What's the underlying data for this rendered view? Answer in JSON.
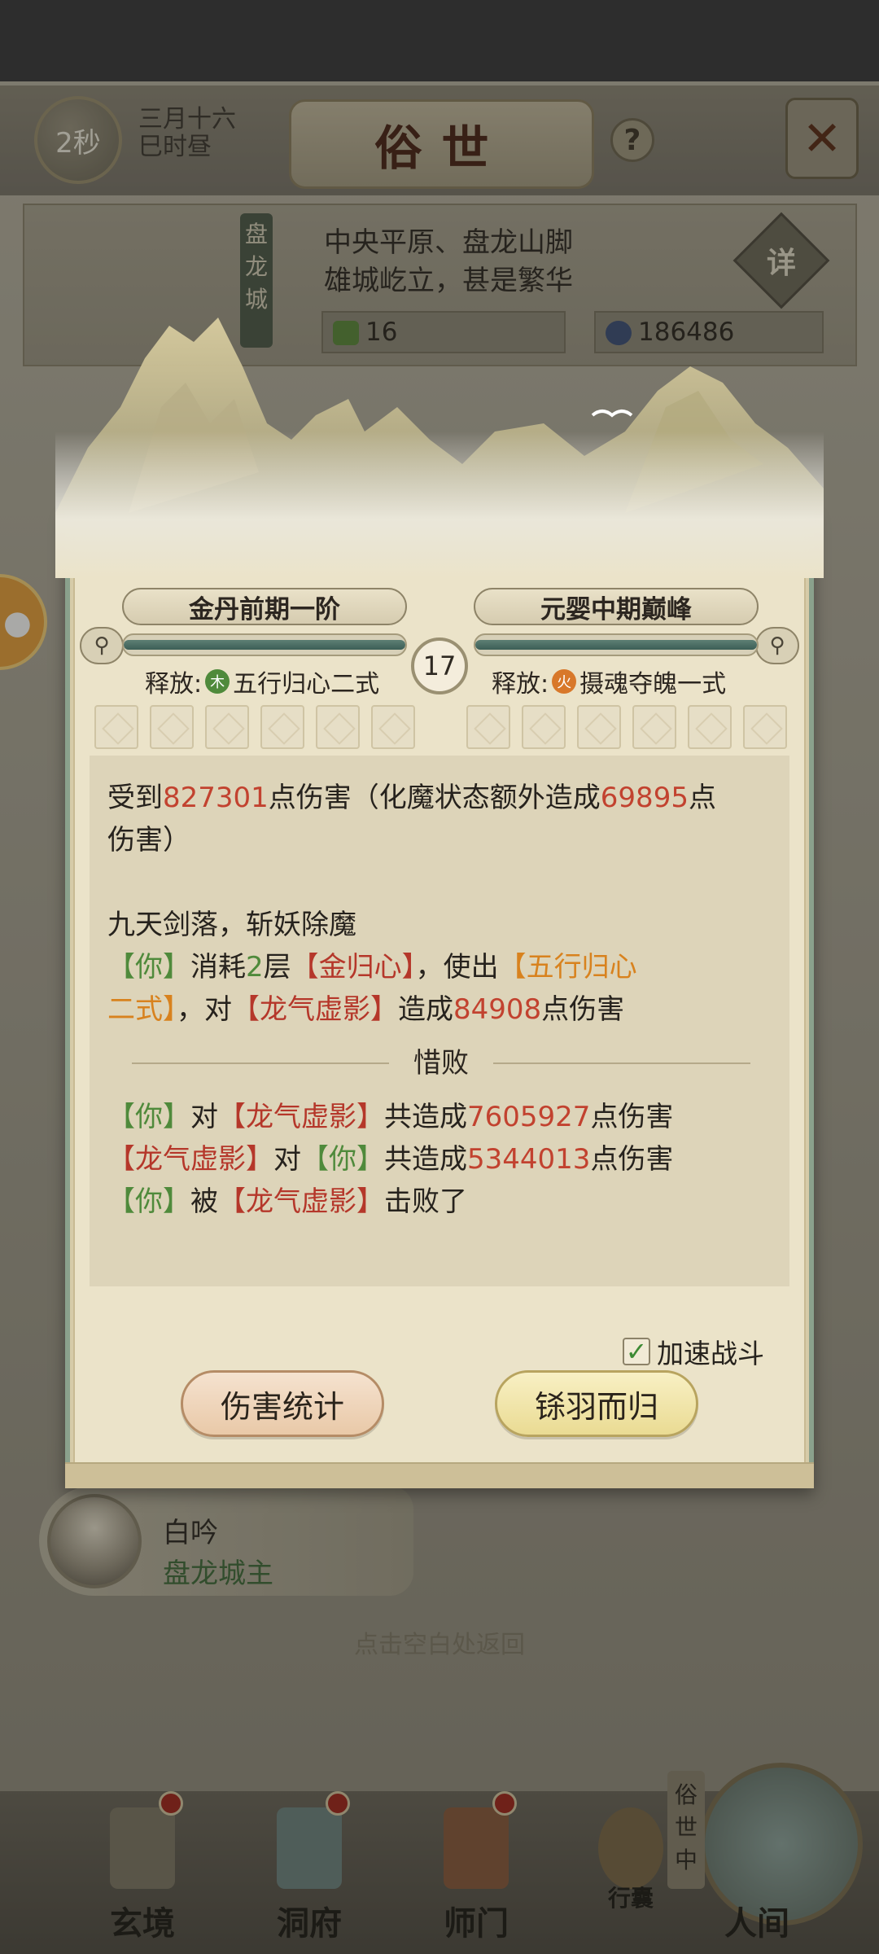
{
  "header": {
    "timer": "2秒",
    "date_line1": "三月十六",
    "date_line2": "巳时昼",
    "title": "俗世",
    "help": "?",
    "close": "✕"
  },
  "city": {
    "name": "盘龙城",
    "desc_line1": "中央平原、盘龙山脚",
    "desc_line2": "雄城屹立，甚是繁华",
    "detail": "详",
    "stat1_value": "16",
    "stat2_value": "186486"
  },
  "battle": {
    "left": {
      "realm": "金丹前期一阶",
      "release_label": "释放:",
      "element": "木",
      "skill": "五行归心二式",
      "hp_fraction": 1.0
    },
    "right": {
      "realm": "元婴中期巅峰",
      "release_label": "释放:",
      "element": "火",
      "skill": "摄魂夺魄一式",
      "hp_fraction": 1.0
    },
    "round": "17"
  },
  "log": {
    "l1": {
      "a": "受到",
      "b": "827301",
      "c": "点伤害（化魔状态额外造成",
      "d": "69895",
      "e": "点"
    },
    "l2": "伤害）",
    "l3": "九天剑落，斩妖除魔",
    "l4": {
      "you": "【你】",
      "a": "消耗",
      "b": "2",
      "c": "层",
      "d": "【金归心】",
      "e": "，使出",
      "f": "【五行归心"
    },
    "l5": {
      "a": "二式】",
      "b": "，对",
      "c": "【龙气虚影】",
      "d": "造成",
      "e": "84908",
      "f": "点伤害"
    },
    "result": "惜败",
    "s1": {
      "you": "【你】",
      "a": "对",
      "b": "【龙气虚影】",
      "c": "共造成",
      "d": "7605927",
      "e": "点伤害"
    },
    "s2": {
      "enemy": "【龙气虚影】",
      "a": "对",
      "you": "【你】",
      "c": "共造成",
      "d": "5344013",
      "e": "点伤害"
    },
    "s3": {
      "you": "【你】",
      "a": "被",
      "b": "【龙气虚影】",
      "c": "击败了"
    }
  },
  "speed_toggle": {
    "label": "加速战斗",
    "checked": true
  },
  "buttons": {
    "stats": "伤害统计",
    "return": "铩羽而归"
  },
  "npc": {
    "name": "白吟",
    "title": "盘龙城主"
  },
  "back_hint": "点击空白处返回",
  "nav": {
    "items": [
      "玄境",
      "洞府",
      "师门",
      "行囊",
      "人间"
    ],
    "world_tag": "俗世中"
  }
}
